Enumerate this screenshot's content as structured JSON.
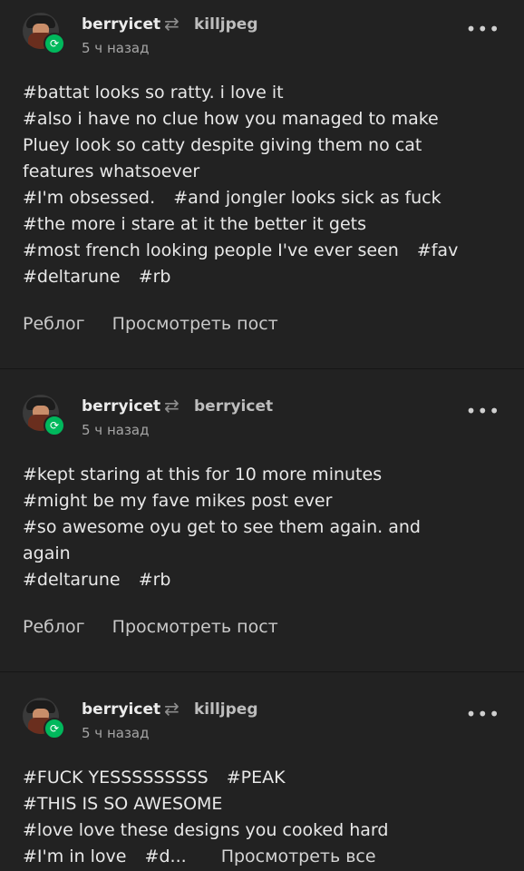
{
  "posts": [
    {
      "user": "berryicet",
      "source": "killjpeg",
      "time": "5 ч назад",
      "lines": [
        [
          "#battat looks so ratty. i love it"
        ],
        [
          "#also i have no clue how you managed to make"
        ],
        [
          "Pluey look so catty despite giving them no cat"
        ],
        [
          "features whatsoever"
        ],
        [
          "#I'm obsessed.",
          "#and jongler looks sick as fuck"
        ],
        [
          "#the more i stare at it the better it gets"
        ],
        [
          "#most french looking people I've ever seen",
          "#fav"
        ],
        [
          "#deltarune",
          "#rb"
        ]
      ],
      "reblog_label": "Реблог",
      "view_post_label": "Просмотреть пост"
    },
    {
      "user": "berryicet",
      "source": "berryicet",
      "time": "5 ч назад",
      "lines": [
        [
          "#kept staring at this for 10 more minutes"
        ],
        [
          "#might be my fave mikes post ever"
        ],
        [
          "#so awesome oyu get to see them again. and"
        ],
        [
          "again"
        ],
        [
          "#deltarune",
          "#rb"
        ]
      ],
      "reblog_label": "Реблог",
      "view_post_label": "Просмотреть пост"
    },
    {
      "user": "berryicet",
      "source": "killjpeg",
      "time": "5 ч назад",
      "lines": [
        [
          "#FUCK YESSSSSSSSS",
          "#PEAK"
        ],
        [
          "#THIS IS SO AWESOME"
        ],
        [
          "#love love these designs you cooked hard"
        ],
        [
          "#I'm in love",
          "#d..."
        ]
      ],
      "view_all_label": "Просмотреть все"
    }
  ],
  "icons": {
    "menu": "more-icon",
    "reblog": "reblog-icon",
    "badge": "reblog-badge-icon"
  },
  "colors": {
    "background": "#222222",
    "badge": "#00b85c"
  }
}
